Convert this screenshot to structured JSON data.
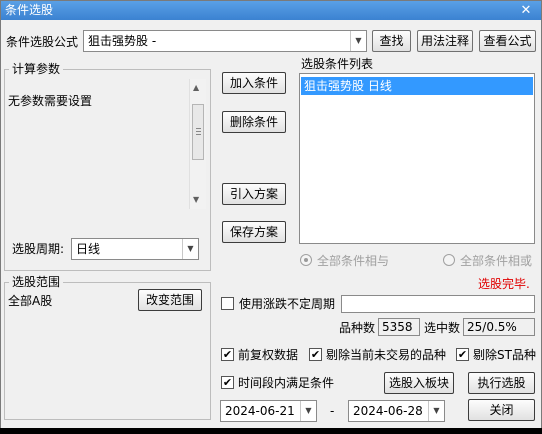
{
  "window": {
    "title": "条件选股",
    "close_glyph": "✕"
  },
  "formula": {
    "label": "条件选股公式",
    "selected": "狙击强势股   -",
    "find_button": "查找",
    "usage_button": "用法注释",
    "view_button": "查看公式"
  },
  "params": {
    "group_title": "计算参数",
    "text": "无参数需要设置",
    "period_label": "选股周期:",
    "period_value": "日线"
  },
  "actions": {
    "add": "加入条件",
    "delete": "删除条件",
    "import": "引入方案",
    "save": "保存方案"
  },
  "condition_list": {
    "title": "选股条件列表",
    "items": [
      "狙击强势股  日线"
    ]
  },
  "logic": {
    "all_and": "全部条件相与",
    "all_or": "全部条件相或"
  },
  "status": {
    "text": "选股完毕.",
    "color": "#e00000"
  },
  "scope": {
    "group_title": "选股范围",
    "value": "全部A股",
    "change_button": "改变范围"
  },
  "options": {
    "variable_period_label": "使用涨跌不定周期",
    "variable_period_value": "",
    "variety_count_label": "品种数",
    "variety_count_value": "5358",
    "selected_label": "选中数",
    "selected_value": "25/0.5%",
    "pre_adjust": "前复权数据",
    "exclude_untraded": "剔除当前未交易的品种",
    "exclude_st": "剔除ST品种",
    "time_range": "时间段内满足条件",
    "check_glyph": "✔"
  },
  "buttons": {
    "to_block": "选股入板块",
    "execute": "执行选股",
    "close": "关闭"
  },
  "dates": {
    "start": "2024-06-21",
    "separator": "-",
    "end": "2024-06-28"
  }
}
